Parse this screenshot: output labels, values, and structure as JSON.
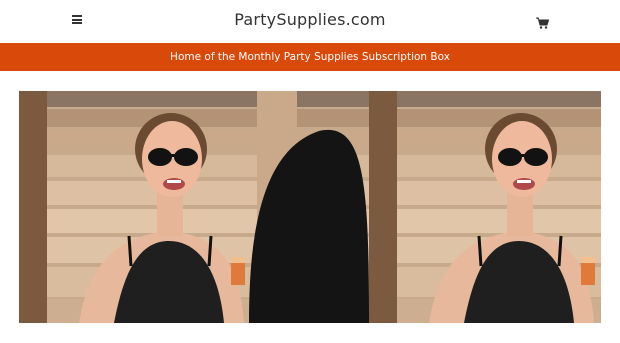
{
  "header": {
    "menu_icon": "hamburger-menu-icon",
    "site_title": "PartySupplies.com",
    "cart_icon": "shopping-cart-icon"
  },
  "announcement": {
    "text": "Home of the Monthly Party Supplies Subscription Box"
  },
  "hero": {
    "image_description_icon": "photo-woman-sunglasses",
    "colors": {
      "banner": "#d8490a",
      "wood": "#c9ab8d",
      "top": "#1f1f1f"
    }
  }
}
